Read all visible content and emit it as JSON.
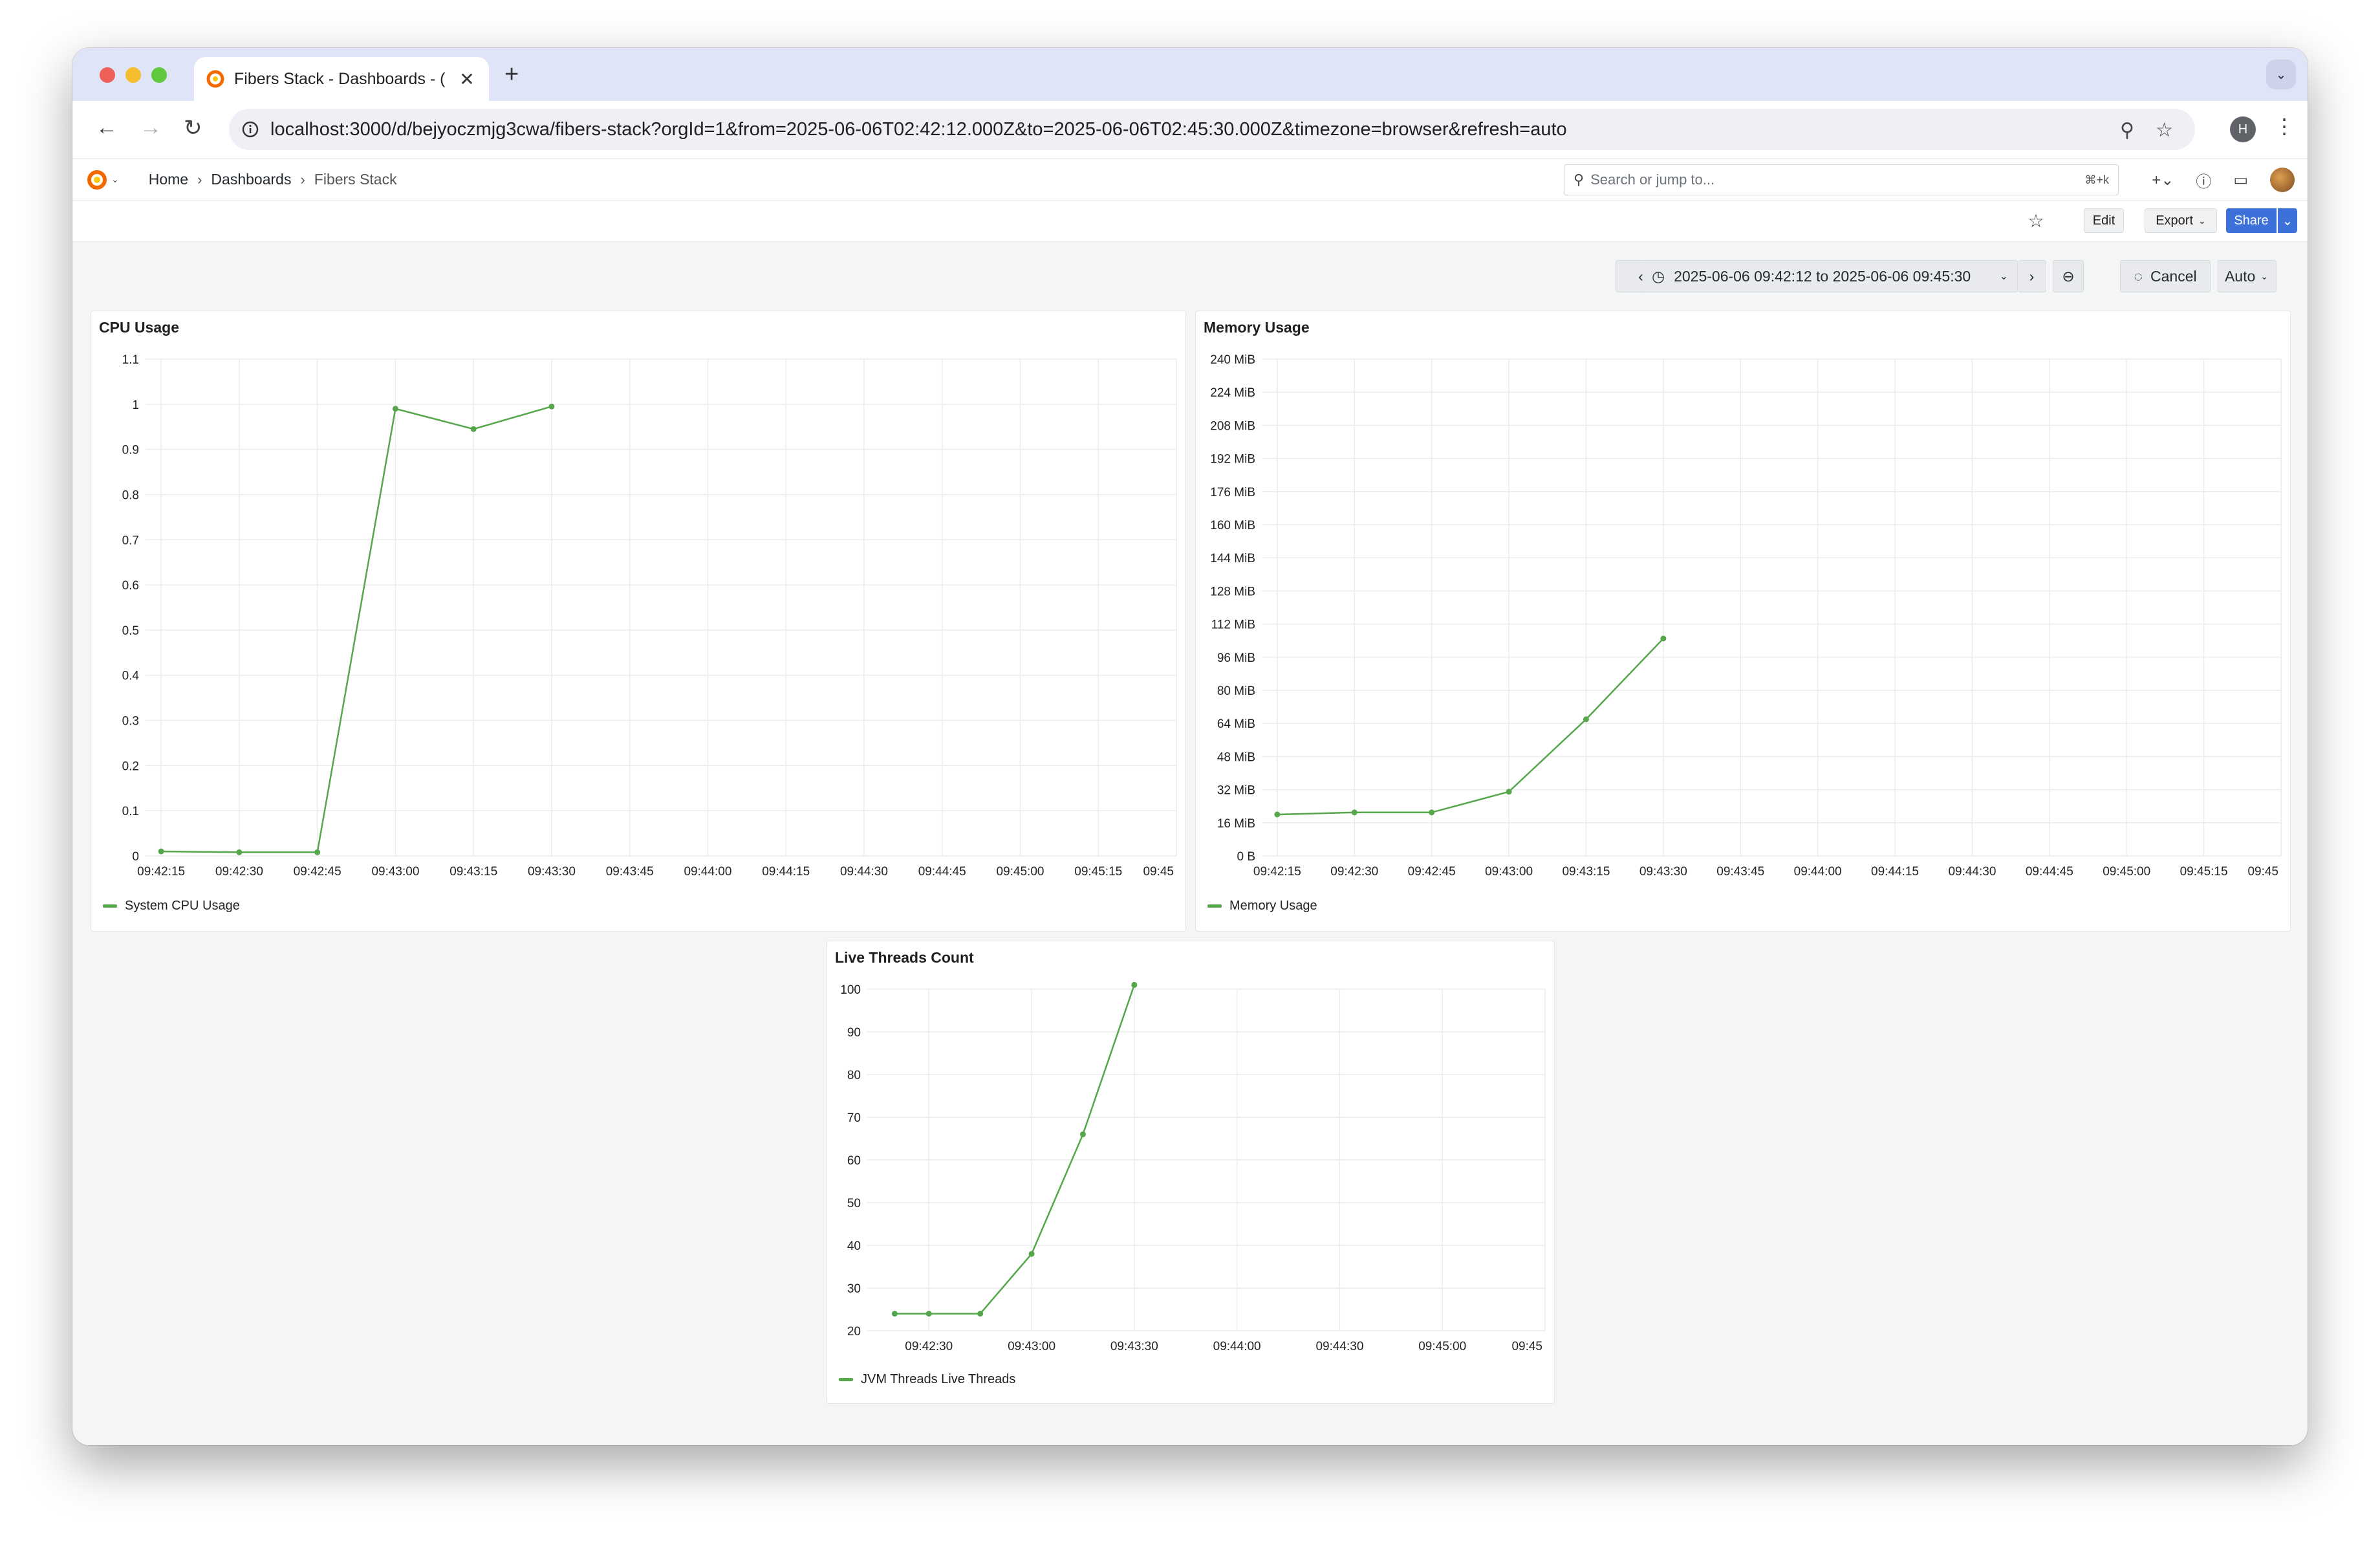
{
  "browser": {
    "tab_title": "Fibers Stack - Dashboards - (",
    "url_host": "localhost",
    "url_rest": ":3000/d/bejyoczmjg3cwa/fibers-stack?orgId=1&from=2025-06-06T02:42:12.000Z&to=2025-06-06T02:45:30.000Z&timezone=browser&refresh=auto",
    "profile_initial": "H"
  },
  "nav": {
    "breadcrumbs": [
      "Home",
      "Dashboards",
      "Fibers Stack"
    ],
    "search_placeholder": "Search or jump to...",
    "search_shortcut": "⌘+k"
  },
  "actions": {
    "edit": "Edit",
    "export": "Export",
    "share": "Share"
  },
  "time": {
    "range": "2025-06-06 09:42:12 to 2025-06-06 09:45:30",
    "cancel": "Cancel",
    "refresh": "Auto"
  },
  "colors": {
    "series": "#56a64b",
    "share_button": "#3d71d9"
  },
  "chart_data": [
    {
      "type": "line",
      "title": "CPU Usage",
      "x": [
        "09:42:15",
        "09:42:30",
        "09:42:45",
        "09:43:00",
        "09:43:15",
        "09:43:30"
      ],
      "xticks": [
        "09:42:15",
        "09:42:30",
        "09:42:45",
        "09:43:00",
        "09:43:15",
        "09:43:30",
        "09:43:45",
        "09:44:00",
        "09:44:15",
        "09:44:30",
        "09:44:45",
        "09:45:00",
        "09:45:15",
        "09:45"
      ],
      "yticks": [
        "0",
        "0.1",
        "0.2",
        "0.3",
        "0.4",
        "0.5",
        "0.6",
        "0.7",
        "0.8",
        "0.9",
        "1",
        "1.1"
      ],
      "ylim": [
        0,
        1.1
      ],
      "series": [
        {
          "name": "System CPU Usage",
          "values": [
            0.01,
            0.008,
            0.008,
            0.99,
            0.945,
            0.995
          ]
        }
      ],
      "legend": "bottom-left",
      "grid": true
    },
    {
      "type": "line",
      "title": "Memory Usage",
      "x": [
        "09:42:15",
        "09:42:30",
        "09:42:45",
        "09:43:00",
        "09:43:15",
        "09:43:30"
      ],
      "xticks": [
        "09:42:15",
        "09:42:30",
        "09:42:45",
        "09:43:00",
        "09:43:15",
        "09:43:30",
        "09:43:45",
        "09:44:00",
        "09:44:15",
        "09:44:30",
        "09:44:45",
        "09:45:00",
        "09:45:15",
        "09:45"
      ],
      "yticks": [
        "0 B",
        "16 MiB",
        "32 MiB",
        "48 MiB",
        "64 MiB",
        "80 MiB",
        "96 MiB",
        "112 MiB",
        "128 MiB",
        "144 MiB",
        "160 MiB",
        "176 MiB",
        "192 MiB",
        "208 MiB",
        "224 MiB",
        "240 MiB"
      ],
      "ylim": [
        0,
        240
      ],
      "y_unit": "MiB",
      "series": [
        {
          "name": "Memory Usage",
          "values": [
            20,
            21,
            21,
            31,
            66,
            105
          ]
        }
      ],
      "legend": "bottom-left",
      "grid": true
    },
    {
      "type": "line",
      "title": "Live Threads Count",
      "x": [
        "09:42:20",
        "09:42:30",
        "09:42:45",
        "09:43:00",
        "09:43:15",
        "09:43:30"
      ],
      "xticks": [
        "09:42:30",
        "09:43:00",
        "09:43:30",
        "09:44:00",
        "09:44:30",
        "09:45:00",
        "09:45"
      ],
      "yticks": [
        "20",
        "30",
        "40",
        "50",
        "60",
        "70",
        "80",
        "90",
        "100"
      ],
      "ylim": [
        20,
        100
      ],
      "series": [
        {
          "name": "JVM Threads Live Threads",
          "values": [
            24,
            24,
            24,
            38,
            66,
            101
          ]
        }
      ],
      "legend": "bottom-left",
      "grid": true
    }
  ]
}
